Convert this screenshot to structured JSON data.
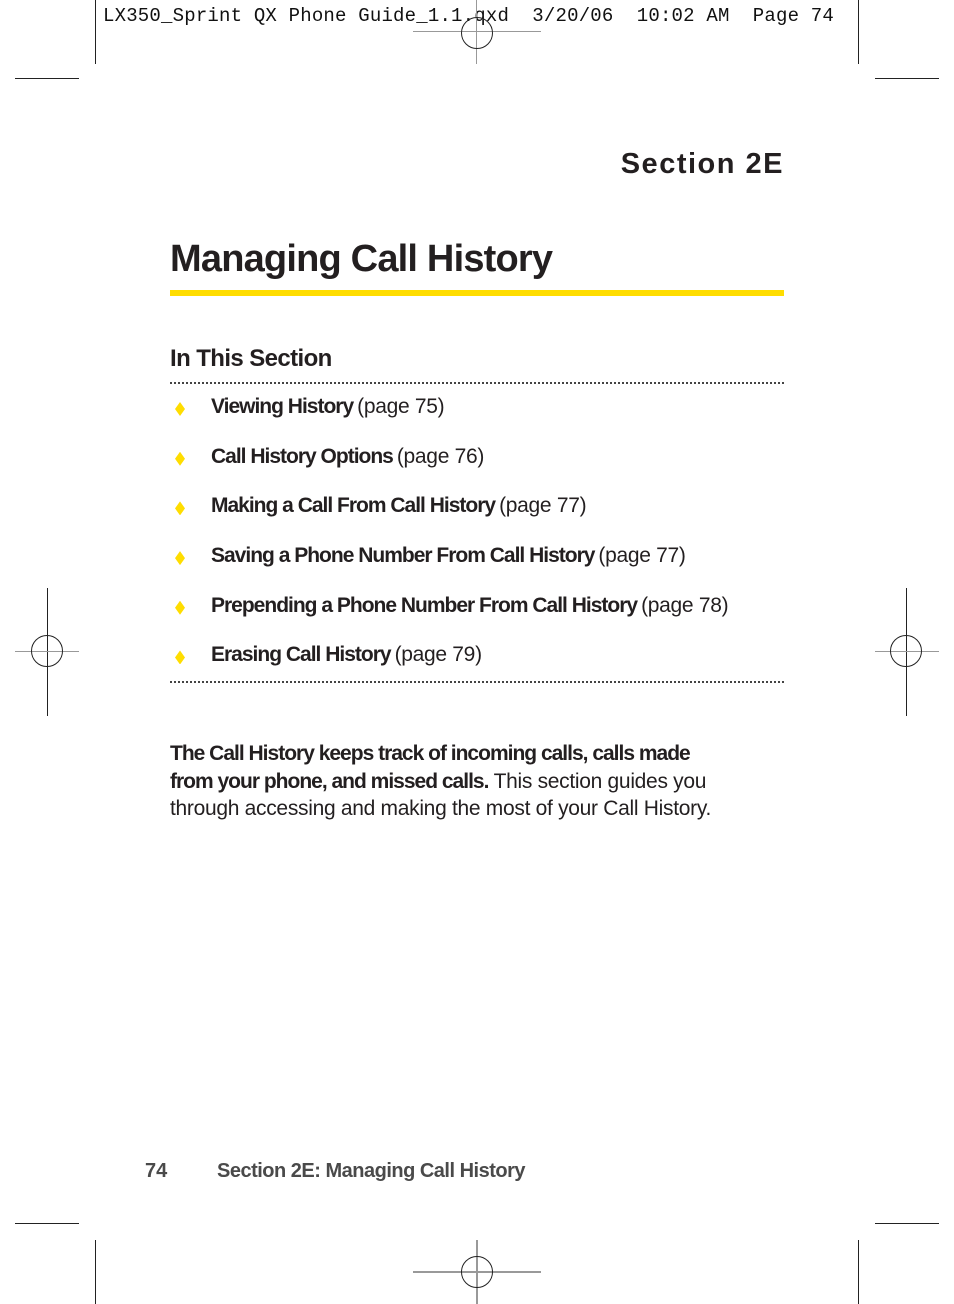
{
  "slug": {
    "filename": "LX350_Sprint QX Phone Guide_1.1.qxd",
    "date": "3/20/06",
    "time": "10:02 AM",
    "page": "Page 74"
  },
  "section_label": "Section 2E",
  "title": "Managing Call History",
  "accent_color": "#FFDD00",
  "in_this_section": {
    "heading": "In This Section",
    "items": [
      {
        "label": "Viewing History",
        "ref": "(page 75)"
      },
      {
        "label": "Call History Options",
        "ref": "(page 76)"
      },
      {
        "label": "Making a Call From Call History",
        "ref": "(page 77)"
      },
      {
        "label": "Saving a Phone Number From Call History",
        "ref": "(page 77)"
      },
      {
        "label": "Prepending a Phone Number From Call History",
        "ref": "(page 78)"
      },
      {
        "label": "Erasing Call History",
        "ref": "(page 79)"
      }
    ]
  },
  "intro": {
    "bold": "The Call History keeps track of incoming calls, calls made from your phone, and missed calls.",
    "text": " This section guides you through accessing and making the most of your Call History."
  },
  "footer": {
    "page_number": "74",
    "running_title": "Section 2E: Managing Call History"
  }
}
